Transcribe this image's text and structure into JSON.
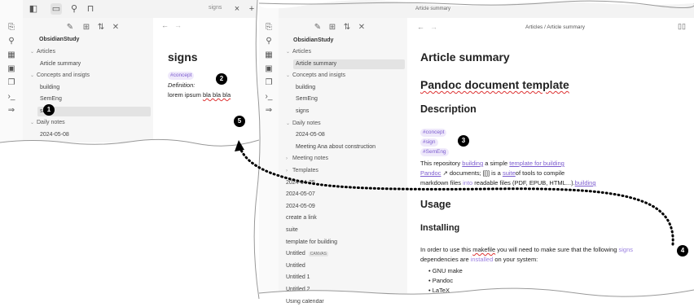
{
  "left_window": {
    "ribbon_icons": [
      "files-icon",
      "graph-icon",
      "canvas-icon",
      "calendar-icon",
      "copy-icon",
      "terminal-icon",
      "arrow-icon"
    ],
    "tab_title": "signs",
    "file_toolbar_icons": [
      "new-note-icon",
      "new-folder-icon",
      "sort-icon",
      "collapse-icon"
    ],
    "vault_name": "ObsidianStudy",
    "tree": [
      {
        "label": "Articles",
        "type": "folder",
        "indent": 0
      },
      {
        "label": "Article summary",
        "type": "file",
        "indent": 1
      },
      {
        "label": "Concepts and insigts",
        "type": "folder",
        "indent": 0
      },
      {
        "label": "building",
        "type": "file",
        "indent": 1
      },
      {
        "label": "SemEng",
        "type": "file",
        "indent": 1
      },
      {
        "label": "signs",
        "type": "file",
        "indent": 1,
        "selected": true
      },
      {
        "label": "Daily notes",
        "type": "folder",
        "indent": 0
      },
      {
        "label": "2024-05-08",
        "type": "file",
        "indent": 1
      }
    ],
    "nav_back": "←",
    "nav_forward": "→",
    "note": {
      "title": "signs",
      "tag": "#concept",
      "definition_label": "Definition:",
      "body_plain": "lorem ipsum ",
      "body_squiggle": "bla bla bla"
    },
    "close_icon": "×",
    "plus_icon": "+"
  },
  "right_window": {
    "tab_title": "Article summary",
    "vault_name": "ObsidianStudy",
    "breadcrumb": "Articles / Article summary",
    "tree": [
      {
        "label": "Articles",
        "type": "folder",
        "indent": 0
      },
      {
        "label": "Article summary",
        "type": "file",
        "indent": 1,
        "selected": true
      },
      {
        "label": "Concepts and insigts",
        "type": "folder",
        "indent": 0
      },
      {
        "label": "building",
        "type": "file",
        "indent": 1
      },
      {
        "label": "SemEng",
        "type": "file",
        "indent": 1
      },
      {
        "label": "signs",
        "type": "file",
        "indent": 1
      },
      {
        "label": "Daily notes",
        "type": "folder",
        "indent": 0
      },
      {
        "label": "2024-05-08",
        "type": "file",
        "indent": 1
      },
      {
        "label": "Meeting Ana about construction",
        "type": "file",
        "indent": 1
      },
      {
        "label": "Meeting notes",
        "type": "folder",
        "indent": 0,
        "collapsed": true
      },
      {
        "label": "Templates",
        "type": "folder",
        "indent": 0,
        "collapsed": true
      },
      {
        "label": "2024-04-25",
        "type": "file",
        "indent": 0
      },
      {
        "label": "2024-05-07",
        "type": "file",
        "indent": 0
      },
      {
        "label": "2024-05-09",
        "type": "file",
        "indent": 0
      },
      {
        "label": "create a link",
        "type": "file",
        "indent": 0
      },
      {
        "label": "suite",
        "type": "file",
        "indent": 0
      },
      {
        "label": "template for building",
        "type": "file",
        "indent": 0
      },
      {
        "label": "Untitled",
        "type": "file",
        "indent": 0,
        "badge": "CANVAS"
      },
      {
        "label": "Untitled",
        "type": "file",
        "indent": 0
      },
      {
        "label": "Untitled 1",
        "type": "file",
        "indent": 0
      },
      {
        "label": "Untitled 2",
        "type": "file",
        "indent": 0
      },
      {
        "label": "Using calendar",
        "type": "file",
        "indent": 0
      }
    ],
    "doc": {
      "h1": "Article summary",
      "h1b": "Pandoc document template",
      "h2_desc": "Description",
      "tags": [
        "#concept",
        "#sign",
        "#SemEng"
      ],
      "line1_a": "This repository ",
      "line1_link1": "building",
      "line1_b": " a simple ",
      "line1_link2": "template for building",
      "line2_link": "Pandoc",
      "line2_a": " ↗ documents; ",
      "line2_b": "[[]]",
      "line2_c": " is a ",
      "line2_link2": "suite",
      "line2_d": "of tools to compile",
      "line3_a": "markdown files ",
      "line3_link1": "into",
      "line3_b": " readable files (PDF, EPUB, HTML...).",
      "line3_link2": "building",
      "h2_usage": "Usage",
      "h3_install": "Installing",
      "inst1_a": "In order to use this ",
      "inst1_sq": "makefile",
      "inst1_b": " you will need to make sure that the following ",
      "inst1_link": "signs",
      "inst2_a": "dependencies are ",
      "inst2_link": "installed",
      "inst2_b": " on your system:",
      "bullets": [
        "• GNU make",
        "• Pandoc",
        "• LaTeX"
      ]
    },
    "reader_icon": "book-icon"
  },
  "callouts": [
    "1",
    "2",
    "3",
    "4",
    "5"
  ]
}
